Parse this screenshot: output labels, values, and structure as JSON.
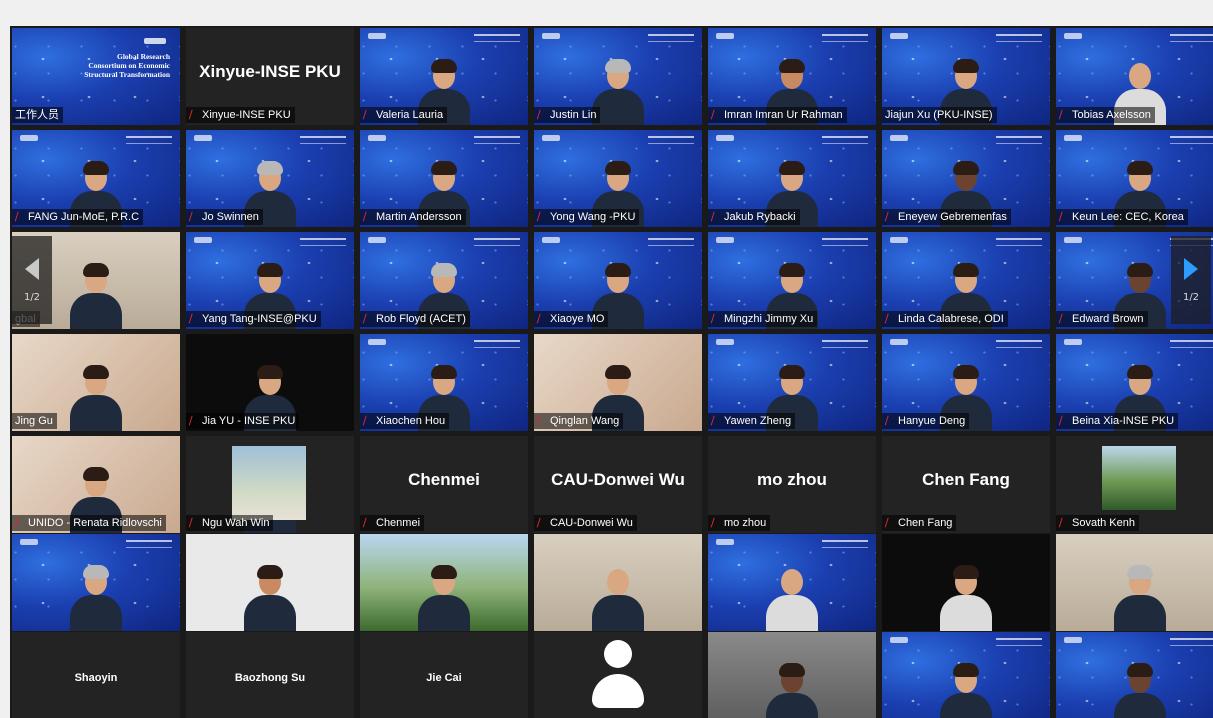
{
  "colors": {
    "gallery_bg": "#1a1a1a",
    "active_speaker": "#e6e65a",
    "muted_icon": "#e0262f",
    "next_arrow": "#2d9cff"
  },
  "pager": {
    "left_page": "1/2",
    "right_page": "1/2"
  },
  "consortium_text": "Global Research Consortium on Economic Structural Transformation",
  "tiles": [
    {
      "name": "工作人员",
      "muted": false
    },
    {
      "name": "Xinyue-INSE PKU",
      "muted": true,
      "big": "Xinyue-INSE PKU"
    },
    {
      "name": "Valeria Lauria",
      "muted": true
    },
    {
      "name": "Justin Lin",
      "muted": true
    },
    {
      "name": "Imran Imran Ur Rahman",
      "muted": true
    },
    {
      "name": "Jiajun Xu (PKU-INSE)",
      "muted": false
    },
    {
      "name": "Tobias Axelsson",
      "muted": true
    },
    {
      "name": "FANG Jun-MoE, P.R.C",
      "muted": true
    },
    {
      "name": "Jo Swinnen",
      "muted": true
    },
    {
      "name": "Martin Andersson",
      "muted": true
    },
    {
      "name": "Yong Wang -PKU",
      "muted": true
    },
    {
      "name": "Jakub Rybacki",
      "muted": true
    },
    {
      "name": "Eneyew Gebremenfas",
      "muted": true
    },
    {
      "name": "Keun Lee: CEC, Korea",
      "muted": true
    },
    {
      "name": "gbal",
      "muted": false
    },
    {
      "name": "Yang Tang-INSE@PKU",
      "muted": true
    },
    {
      "name": "Rob Floyd (ACET)",
      "muted": true
    },
    {
      "name": "Xiaoye MO",
      "muted": true
    },
    {
      "name": "Mingzhi Jimmy Xu",
      "muted": true
    },
    {
      "name": "Linda Calabrese, ODI",
      "muted": true
    },
    {
      "name": "Edward Brown",
      "muted": true
    },
    {
      "name": "Jing Gu",
      "muted": false
    },
    {
      "name": "Jia YU - INSE PKU",
      "muted": true
    },
    {
      "name": "Xiaochen Hou",
      "muted": true
    },
    {
      "name": "Qinglan Wang",
      "muted": true
    },
    {
      "name": "Yawen Zheng",
      "muted": true
    },
    {
      "name": "Hanyue Deng",
      "muted": true
    },
    {
      "name": "Beina Xia-INSE PKU",
      "muted": true
    },
    {
      "name": "UNIDO - Renata Ridlovschi",
      "muted": true
    },
    {
      "name": "Ngu Wah Win",
      "muted": true
    },
    {
      "name": "Chenmei",
      "muted": true,
      "big": "Chenmei"
    },
    {
      "name": "CAU-Donwei Wu",
      "muted": true,
      "big": "CAU-Donwei Wu"
    },
    {
      "name": "mo zhou",
      "muted": true,
      "big": "mo zhou"
    },
    {
      "name": "Chen Fang",
      "muted": true,
      "big": "Chen Fang"
    },
    {
      "name": "Sovath Kenh",
      "muted": true
    },
    {
      "name": "",
      "muted": false
    },
    {
      "name": "",
      "muted": false
    },
    {
      "name": "",
      "muted": false
    },
    {
      "name": "",
      "muted": false
    },
    {
      "name": "",
      "muted": false
    },
    {
      "name": "",
      "muted": false
    },
    {
      "name": "",
      "muted": false
    },
    {
      "name": "",
      "muted": false,
      "small": "Shaoyin"
    },
    {
      "name": "",
      "muted": false,
      "small": "Baozhong Su"
    },
    {
      "name": "",
      "muted": false,
      "small": "Jie Cai"
    },
    {
      "name": "",
      "muted": false
    },
    {
      "name": "",
      "muted": false
    },
    {
      "name": "",
      "muted": false
    },
    {
      "name": "",
      "muted": false
    }
  ]
}
